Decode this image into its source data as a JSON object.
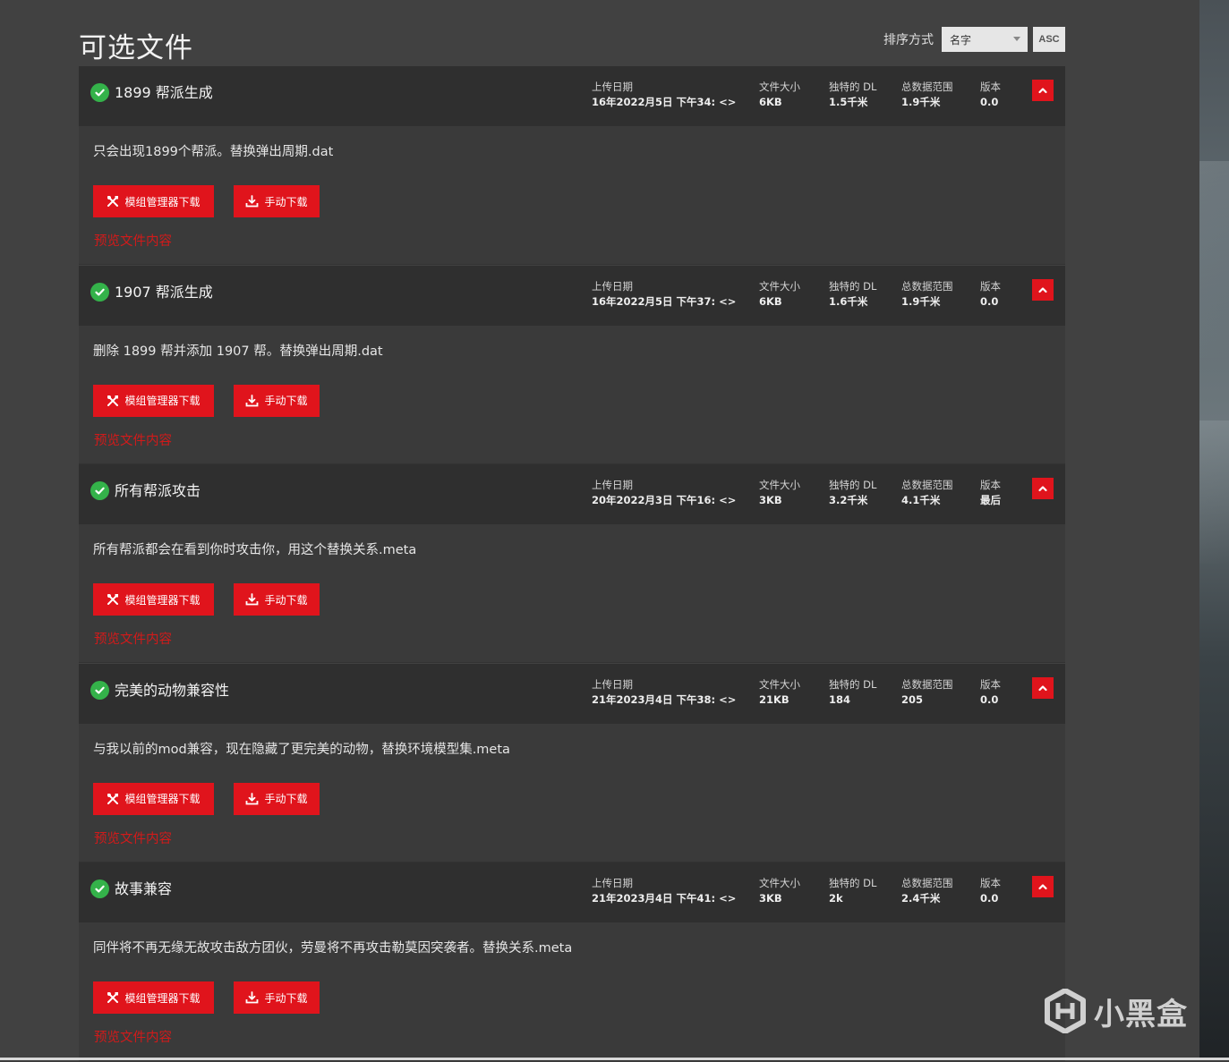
{
  "title": "可选文件",
  "sort": {
    "label": "排序方式",
    "selected": "名字",
    "order": "ASC"
  },
  "labels": {
    "upload_date": "上传日期",
    "file_size": "文件大小",
    "unique_dl": "独特的 DL",
    "total_range": "总数据范围",
    "version": "版本",
    "mod_manager_download": "模组管理器下载",
    "manual_download": "手动下载",
    "preview": "预览文件内容"
  },
  "files": [
    {
      "name": "1899 帮派生成",
      "date": "16年2022月5日 下午34: <>",
      "size": "6KB",
      "unique_dl": "1.5千米",
      "total": "1.9千米",
      "version": "0.0",
      "desc": "只会出现1899个帮派。替换弹出周期.dat"
    },
    {
      "name": "1907 帮派生成",
      "date": "16年2022月5日 下午37: <>",
      "size": "6KB",
      "unique_dl": "1.6千米",
      "total": "1.9千米",
      "version": "0.0",
      "desc": "删除 1899 帮并添加 1907 帮。替换弹出周期.dat"
    },
    {
      "name": "所有帮派攻击",
      "date": "20年2022月3日 下午16: <>",
      "size": "3KB",
      "unique_dl": "3.2千米",
      "total": "4.1千米",
      "version": "最后",
      "desc": "所有帮派都会在看到你时攻击你，用这个替换关系.meta"
    },
    {
      "name": "完美的动物兼容性",
      "date": "21年2023月4日 下午38: <>",
      "size": "21KB",
      "unique_dl": "184",
      "total": "205",
      "version": "0.0",
      "desc": "与我以前的mod兼容，现在隐藏了更完美的动物，替换环境模型集.meta"
    },
    {
      "name": "故事兼容",
      "date": "21年2023月4日 下午41: <>",
      "size": "3KB",
      "unique_dl": "2k",
      "total": "2.4千米",
      "version": "0.0",
      "desc": "同伴将不再无缘无故攻击敌方团伙，劳曼将不再攻击勒莫因突袭者。替换关系.meta"
    }
  ],
  "watermark": {
    "text": "小黑盒",
    "icon": "xiaoheihe-logo-icon"
  },
  "colors": {
    "accent": "#e0141c",
    "check": "#34b24a",
    "header_bg": "#2f2f2f",
    "body_bg": "#3a3a3a"
  }
}
